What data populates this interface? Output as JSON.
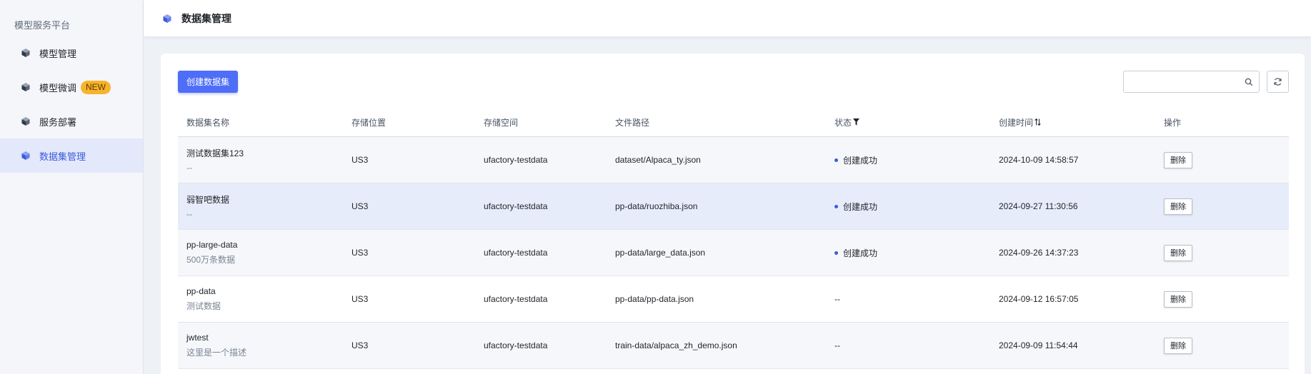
{
  "sidebar": {
    "title": "模型服务平台",
    "items": [
      {
        "label": "模型管理",
        "icon": "cube-icon"
      },
      {
        "label": "模型微调",
        "icon": "cube-icon",
        "badge": "NEW"
      },
      {
        "label": "服务部署",
        "icon": "cube-icon"
      },
      {
        "label": "数据集管理",
        "icon": "cube-icon",
        "active": true
      }
    ]
  },
  "header": {
    "title": "数据集管理",
    "icon": "cube-icon"
  },
  "toolbar": {
    "create_label": "创建数据集",
    "search_placeholder": "",
    "search_icon": "search-icon",
    "refresh_icon": "refresh-icon"
  },
  "table": {
    "columns": [
      "数据集名称",
      "存储位置",
      "存储空间",
      "文件路径",
      "状态",
      "创建时间",
      "操作"
    ],
    "rows": [
      {
        "name": "测试数据集123",
        "desc": "--",
        "location": "US3",
        "space": "ufactory-testdata",
        "path": "dataset/Alpaca_ty.json",
        "status": "创建成功",
        "created": "2024-10-09 14:58:57",
        "action": "删除"
      },
      {
        "name": "弱智吧数据",
        "desc": "--",
        "location": "US3",
        "space": "ufactory-testdata",
        "path": "pp-data/ruozhiba.json",
        "status": "创建成功",
        "created": "2024-09-27 11:30:56",
        "action": "删除"
      },
      {
        "name": "pp-large-data",
        "desc": "500万条数据",
        "location": "US3",
        "space": "ufactory-testdata",
        "path": "pp-data/large_data.json",
        "status": "创建成功",
        "created": "2024-09-26 14:37:23",
        "action": "删除"
      },
      {
        "name": "pp-data",
        "desc": "测试数据",
        "location": "US3",
        "space": "ufactory-testdata",
        "path": "pp-data/pp-data.json",
        "status": "--",
        "created": "2024-09-12 16:57:05",
        "action": "删除"
      },
      {
        "name": "jwtest",
        "desc": "这里是一个描述",
        "location": "US3",
        "space": "ufactory-testdata",
        "path": "train-data/alpaca_zh_demo.json",
        "status": "--",
        "created": "2024-09-09 11:54:44",
        "action": "删除"
      }
    ]
  },
  "colors": {
    "accent": "#4f6ef7",
    "active_bg": "#e3e8fb",
    "badge": "#f7b32b",
    "status_dot": "#3b5bdb"
  }
}
